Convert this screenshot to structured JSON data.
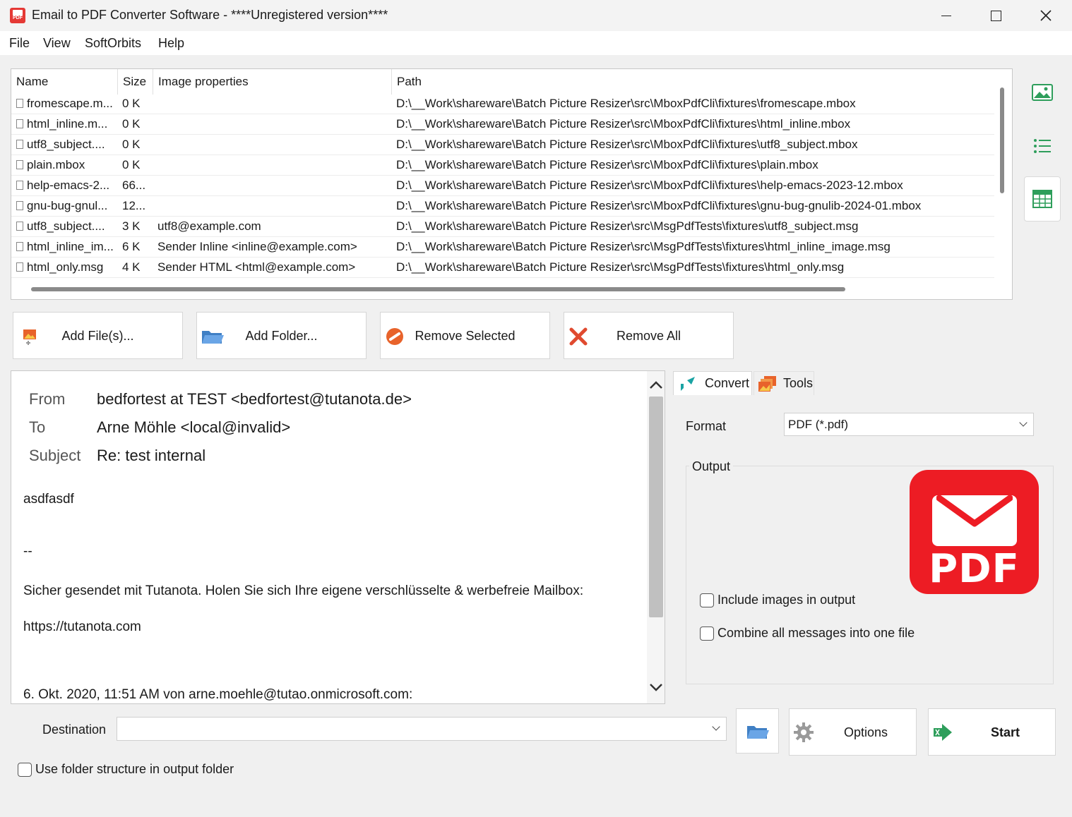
{
  "window": {
    "title": "Email to PDF Converter Software - ****Unregistered version****",
    "icon_text": "PDF"
  },
  "menu": [
    "File",
    "View",
    "SoftOrbits",
    "Help"
  ],
  "file_list": {
    "columns": [
      "Name",
      "Size",
      "Image properties",
      "Path"
    ],
    "rows": [
      {
        "name": "fromescape.m...",
        "size": "0 K",
        "props": "",
        "path": "D:\\__Work\\shareware\\Batch Picture Resizer\\src\\MboxPdfCli\\fixtures\\fromescape.mbox"
      },
      {
        "name": "html_inline.m...",
        "size": "0 K",
        "props": "",
        "path": "D:\\__Work\\shareware\\Batch Picture Resizer\\src\\MboxPdfCli\\fixtures\\html_inline.mbox"
      },
      {
        "name": "utf8_subject....",
        "size": "0 K",
        "props": "",
        "path": "D:\\__Work\\shareware\\Batch Picture Resizer\\src\\MboxPdfCli\\fixtures\\utf8_subject.mbox"
      },
      {
        "name": "plain.mbox",
        "size": "0 K",
        "props": "",
        "path": "D:\\__Work\\shareware\\Batch Picture Resizer\\src\\MboxPdfCli\\fixtures\\plain.mbox"
      },
      {
        "name": "help-emacs-2...",
        "size": "66...",
        "props": "",
        "path": "D:\\__Work\\shareware\\Batch Picture Resizer\\src\\MboxPdfCli\\fixtures\\help-emacs-2023-12.mbox"
      },
      {
        "name": "gnu-bug-gnul...",
        "size": "12...",
        "props": "",
        "path": "D:\\__Work\\shareware\\Batch Picture Resizer\\src\\MboxPdfCli\\fixtures\\gnu-bug-gnulib-2024-01.mbox"
      },
      {
        "name": "utf8_subject....",
        "size": "3 K",
        "props": "utf8@example.com",
        "path": "D:\\__Work\\shareware\\Batch Picture Resizer\\src\\MsgPdfTests\\fixtures\\utf8_subject.msg"
      },
      {
        "name": "html_inline_im...",
        "size": "6 K",
        "props": "Sender Inline <inline@example.com>",
        "path": "D:\\__Work\\shareware\\Batch Picture Resizer\\src\\MsgPdfTests\\fixtures\\html_inline_image.msg"
      },
      {
        "name": "html_only.msg",
        "size": "4 K",
        "props": "Sender HTML <html@example.com>",
        "path": "D:\\__Work\\shareware\\Batch Picture Resizer\\src\\MsgPdfTests\\fixtures\\html_only.msg"
      }
    ]
  },
  "actions": {
    "add_files": "Add File(s)...",
    "add_folder": "Add Folder...",
    "remove_selected": "Remove Selected",
    "remove_all": "Remove All"
  },
  "preview": {
    "from_label": "From",
    "from_value": "bedfortest at TEST <bedfortest@tutanota.de>",
    "to_label": "To",
    "to_value": "Arne Möhle <local@invalid>",
    "subject_label": "Subject",
    "subject_value": "Re: test internal",
    "body_lines": [
      "asdfasdf",
      "--",
      "Sicher gesendet mit Tutanota. Holen Sie sich Ihre eigene verschlüsselte & werbefreie Mailbox:",
      "https://tutanota.com",
      "6. Okt. 2020, 11:51 AM von arne.moehle@tutao.onmicrosoft.com:"
    ]
  },
  "tabs": {
    "convert": "Convert",
    "tools": "Tools"
  },
  "convert_panel": {
    "format_label": "Format",
    "format_value": "PDF (*.pdf)",
    "output_label": "Output",
    "include_images_label": "Include images in output",
    "include_images_checked": false,
    "combine_label": "Combine all messages into one file",
    "combine_checked": false,
    "logo_text": "PDF"
  },
  "bottom": {
    "destination_label": "Destination",
    "destination_value": "",
    "options_label": "Options",
    "start_label": "Start",
    "use_folder_label": "Use folder structure in output folder",
    "use_folder_checked": false
  },
  "colors": {
    "brand_red": "#ed1c24",
    "accent_green": "#2e9e5b"
  }
}
